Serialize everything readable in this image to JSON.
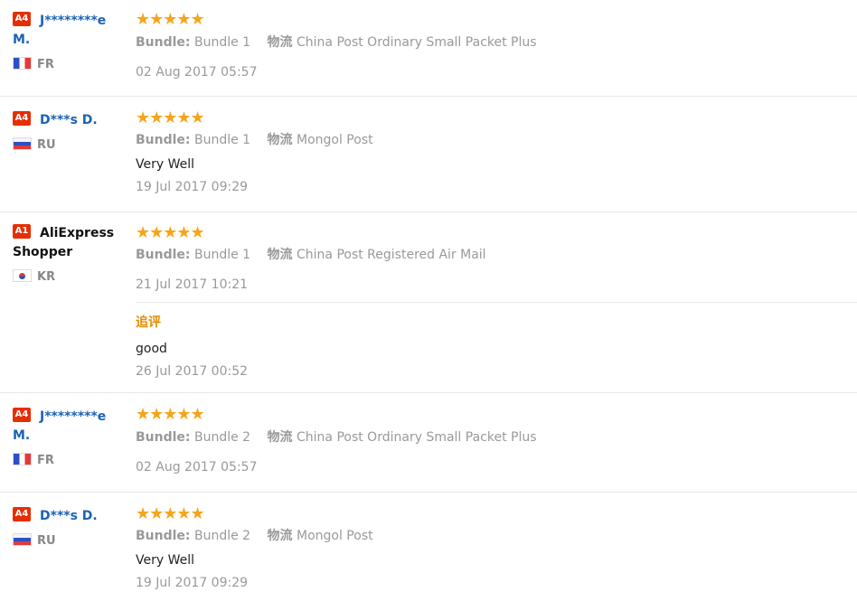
{
  "reviews": [
    {
      "badge": "A4",
      "name_line1": "J********e",
      "name_line2": "M.",
      "country": "FR",
      "stars": "★★★★★",
      "bundle_label": "Bundle:",
      "bundle_value": "Bundle 1",
      "ship_label": "物流",
      "ship_value": "China Post Ordinary Small Packet Plus",
      "comment": "",
      "date": "02 Aug 2017 05:57"
    },
    {
      "badge": "A4",
      "name_line1": "D***s D.",
      "country": "RU",
      "stars": "★★★★★",
      "bundle_label": "Bundle:",
      "bundle_value": "Bundle 1",
      "ship_label": "物流",
      "ship_value": "Mongol Post",
      "comment": "Very Well",
      "date": "19 Jul 2017 09:29"
    },
    {
      "badge": "A1",
      "name_line1": "AliExpress",
      "name_line2": "Shopper",
      "country": "KR",
      "stars": "★★★★★",
      "bundle_label": "Bundle:",
      "bundle_value": "Bundle 1",
      "ship_label": "物流",
      "ship_value": "China Post Registered Air Mail",
      "comment": "",
      "date": "21 Jul 2017 10:21",
      "append_label": "追评",
      "append_comment": "good",
      "append_date": "26 Jul 2017 00:52"
    },
    {
      "badge": "A4",
      "name_line1": "J********e",
      "name_line2": "M.",
      "country": "FR",
      "stars": "★★★★★",
      "bundle_label": "Bundle:",
      "bundle_value": "Bundle 2",
      "ship_label": "物流",
      "ship_value": "China Post Ordinary Small Packet Plus",
      "comment": "",
      "date": "02 Aug 2017 05:57"
    },
    {
      "badge": "A4",
      "name_line1": "D***s D.",
      "country": "RU",
      "stars": "★★★★★",
      "bundle_label": "Bundle:",
      "bundle_value": "Bundle 2",
      "ship_label": "物流",
      "ship_value": "Mongol Post",
      "comment": "Very Well",
      "date": "19 Jul 2017 09:29"
    }
  ]
}
